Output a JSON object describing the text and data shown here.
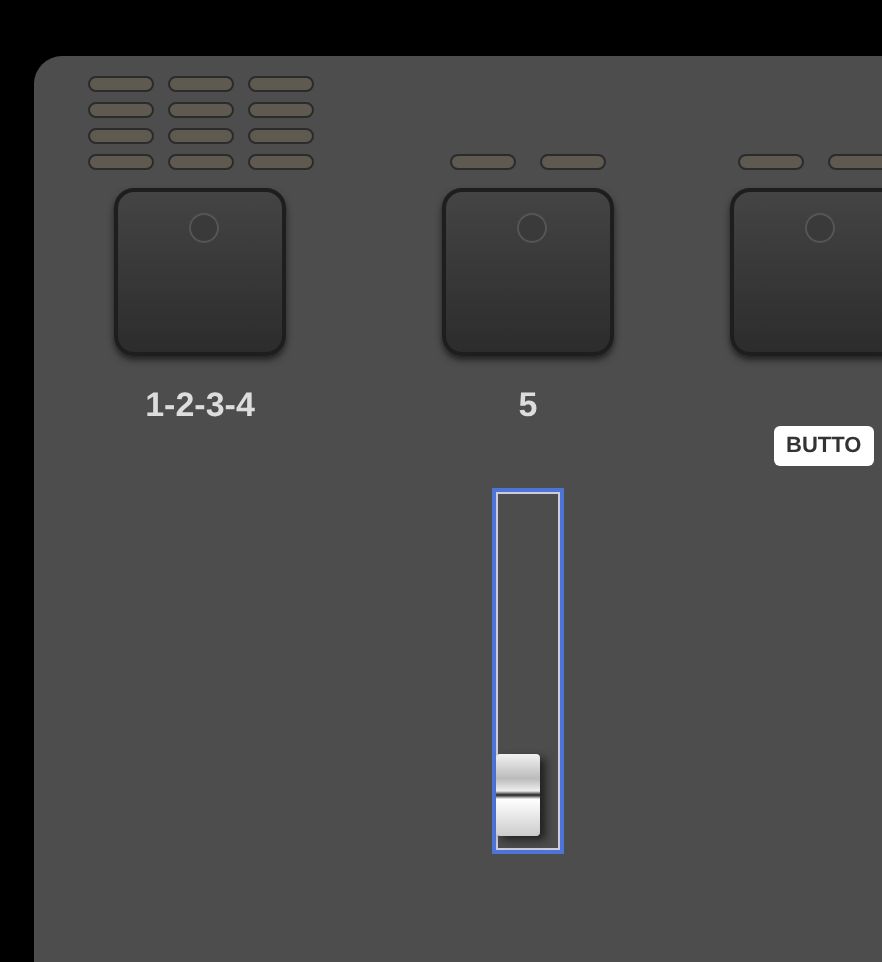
{
  "pads": [
    {
      "label": "1-2-3-4",
      "leds": [
        {
          "on": false
        },
        {
          "on": false
        },
        {
          "on": false
        },
        {
          "on": false
        },
        {
          "on": false
        },
        {
          "on": false
        },
        {
          "on": false
        },
        {
          "on": false
        },
        {
          "on": false
        },
        {
          "on": false
        },
        {
          "on": false
        },
        {
          "on": false
        }
      ]
    },
    {
      "label": "5",
      "leds": [
        {
          "on": false
        },
        {
          "on": false
        }
      ],
      "fader": {
        "level": 0.05,
        "selected": true
      }
    },
    {
      "leds": [
        {
          "on": false
        },
        {
          "on": false
        }
      ],
      "tooltip": "BUTTO"
    }
  ]
}
